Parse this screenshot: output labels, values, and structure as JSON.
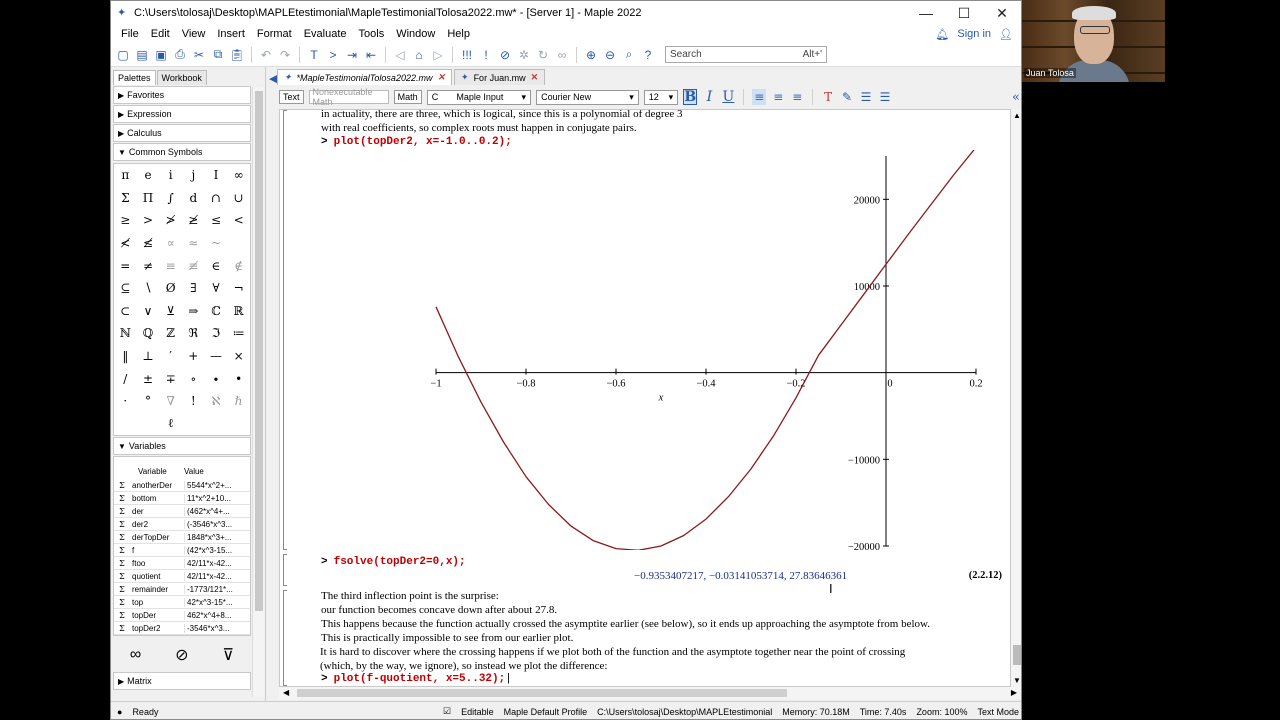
{
  "window": {
    "title": "C:\\Users\\tolosaj\\Desktop\\MAPLEtestimonial\\MapleTestimonialTolosa2022.mw* - [Server 1] - Maple 2022",
    "controls": [
      "—",
      "☐",
      "✕"
    ]
  },
  "menu": {
    "items": [
      "File",
      "Edit",
      "View",
      "Insert",
      "Format",
      "Evaluate",
      "Tools",
      "Window",
      "Help"
    ],
    "sign_in": "Sign in"
  },
  "search": {
    "placeholder": "Search",
    "shortcut": "Alt+'"
  },
  "palettes": {
    "tabs": [
      "Palettes",
      "Workbook"
    ],
    "sections": {
      "favorites": "Favorites",
      "expression": "Expression",
      "calculus": "Calculus",
      "common_symbols": "Common Symbols",
      "variables": "Variables",
      "matrix": "Matrix"
    },
    "symbols": [
      "π",
      "e",
      "i",
      "j",
      "I",
      "∞",
      "Σ",
      "Π",
      "∫",
      "d",
      "∩",
      "∪",
      "≥",
      ">",
      "≯",
      "≱",
      "≤",
      "<",
      "≮",
      "≰",
      "∝",
      "≈",
      "~",
      " ",
      "=",
      "≠",
      "≡",
      "≢",
      "∈",
      "∉",
      "⊆",
      "∖",
      "Ø",
      "∃",
      "∀",
      "¬",
      "⊂",
      "∨",
      "⊻",
      "⇒",
      "ℂ",
      "ℝ",
      "ℕ",
      "ℚ",
      "ℤ",
      "ℜ",
      "ℑ",
      "≔",
      "‖",
      "⊥",
      "′",
      "+",
      "—",
      "×",
      "/",
      "±",
      "∓",
      "∘",
      "∙",
      "•",
      "·",
      "°",
      "∇",
      "!",
      "ℵ",
      "ℏ",
      " ",
      " ",
      "ℓ",
      " ",
      " ",
      " "
    ],
    "variables": {
      "headers": [
        "Variable",
        "Value"
      ],
      "rows": [
        {
          "name": "anotherDer",
          "value": "5544*x^2+..."
        },
        {
          "name": "bottom",
          "value": "11*x^2+10..."
        },
        {
          "name": "der",
          "value": "(462*x^4+..."
        },
        {
          "name": "der2",
          "value": "(-3546*x^3..."
        },
        {
          "name": "derTopDer",
          "value": "1848*x^3+..."
        },
        {
          "name": "f",
          "value": "(42*x^3-15..."
        },
        {
          "name": "ftoo",
          "value": "42/11*x-42..."
        },
        {
          "name": "quotient",
          "value": "42/11*x-42..."
        },
        {
          "name": "remainder",
          "value": "-1773/121*..."
        },
        {
          "name": "top",
          "value": "42*x^3-15*..."
        },
        {
          "name": "topDer",
          "value": "462*x^4+8..."
        },
        {
          "name": "topDer2",
          "value": "-3546*x^3..."
        }
      ]
    }
  },
  "doc_tabs": [
    {
      "label": "*MapleTestimonialTolosa2022.mw"
    },
    {
      "label": "For Juan.mw"
    }
  ],
  "format_bar": {
    "text_btn": "Text",
    "nonexec_btn": "Nonexecutable Math",
    "math_btn": "Math",
    "input_mode": "Maple Input",
    "font": "Courier New",
    "size": "12"
  },
  "document": {
    "text_top": [
      "in actuality, there are three, which is logical, since this is a polynomial of degree 3",
      "with real coefficients, so complex roots must happen in conjugate pairs."
    ],
    "cmd1": "plot(topDer2, x=-1.0..0.2);",
    "cmd2": "fsolve(topDer2=0,x);",
    "result": "−0.9353407217, −0.03141053714, 27.83646361",
    "eq_label": "(2.2.12)",
    "paragraph": [
      "The third inflection point is the surprise:",
      "our function becomes concave down after about 27.8.",
      "This happens because the function actually crossed the asymptite earlier (see below), so it ends up approaching the asymptote from below.",
      "This is practically impossible to see from our earlier plot.",
      "It is hard to discover where the crossing happens if  we plot both of the function and the asymptote together near the point of crossing",
      "(which, by the way, we ignore), so instead we plot the difference:"
    ],
    "cmd3": "plot(f-quotient, x=5..32);",
    "prompt": ">"
  },
  "chart_data": {
    "type": "line",
    "xlabel": "x",
    "ylabel": "",
    "xlim": [
      -1.0,
      0.2
    ],
    "ylim": [
      -20000,
      25000
    ],
    "xticks": [
      -1,
      -0.8,
      -0.6,
      -0.4,
      -0.2,
      0,
      0.2
    ],
    "xtick_labels": [
      "−1",
      "−0.8",
      "−0.6",
      "−0.4",
      "−0.2",
      "0",
      "0.2"
    ],
    "yticks": [
      -20000,
      -10000,
      10000,
      20000
    ],
    "ytick_labels": [
      "−20000",
      "−10000",
      "10000",
      "20000"
    ],
    "series": [
      {
        "color": "#8b1a1a",
        "x": [
          -1.0,
          -0.95,
          -0.9,
          -0.85,
          -0.8,
          -0.75,
          -0.7,
          -0.65,
          -0.6,
          -0.55,
          -0.5,
          -0.45,
          -0.4,
          -0.35,
          -0.3,
          -0.25,
          -0.2,
          -0.15,
          -0.1,
          -0.05,
          0.0,
          0.05,
          0.1,
          0.15,
          0.2
        ],
        "y": [
          7600,
          1800,
          -3400,
          -8000,
          -12000,
          -15200,
          -17700,
          -19400,
          -20300,
          -20500,
          -20000,
          -18800,
          -16900,
          -14300,
          -11100,
          -7300,
          -2900,
          2000,
          5500,
          9000,
          12500,
          16000,
          19400,
          22800,
          26000
        ]
      }
    ],
    "grid": false
  },
  "status": {
    "ready": "Ready",
    "editable": "Editable",
    "profile": "Maple Default Profile",
    "path": "C:\\Users\\tolosaj\\Desktop\\MAPLEtestimonial",
    "memory": "Memory: 70.18M",
    "time": "Time: 7.40s",
    "zoom": "Zoom: 100%",
    "mode": "Text Mode"
  },
  "webcam": {
    "name": "Juan Tolosa"
  }
}
